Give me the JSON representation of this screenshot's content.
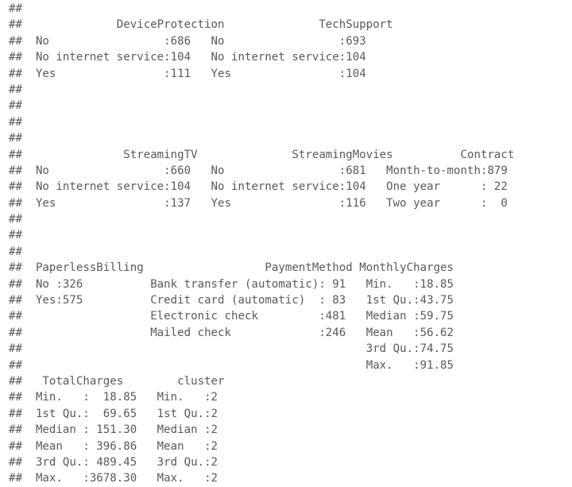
{
  "console": {
    "comment_prefix": "##",
    "text_color": "#5a5a5a",
    "background_color": "#ffffff",
    "lines": [
      "## ",
      "##              DeviceProtection              TechSupport  ",
      "##  No                 :686   No                 :693      ",
      "##  No internet service:104   No internet service:104      ",
      "##  Yes                :111   Yes                :104      ",
      "## ",
      "## ",
      "## ",
      "## ",
      "##               StreamingTV              StreamingMovies          Contract  ",
      "##  No                 :660   No                 :681   Month-to-month:879   ",
      "##  No internet service:104   No internet service:104   One year      : 22   ",
      "##  Yes                :137   Yes                :116   Two year      :  0   ",
      "## ",
      "## ",
      "## ",
      "##  PaperlessBilling                  PaymentMethod MonthlyCharges ",
      "##  No :326          Bank transfer (automatic): 91   Min.   :18.85 ",
      "##  Yes:575          Credit card (automatic)  : 83   1st Qu.:43.75 ",
      "##                   Electronic check         :481   Median :59.75 ",
      "##                   Mailed check             :246   Mean   :56.62 ",
      "##                                                   3rd Qu.:74.75 ",
      "##                                                   Max.   :91.85 ",
      "##   TotalCharges        cluster ",
      "##  Min.   :  18.85   Min.   :2  ",
      "##  1st Qu.:  69.65   1st Qu.:2  ",
      "##  Median : 151.30   Median :2  ",
      "##  Mean   : 396.86   Mean   :2  ",
      "##  3rd Qu.: 489.45   3rd Qu.:2  ",
      "##  Max.   :3678.30   Max.   :2  "
    ],
    "variables": {
      "DeviceProtection": {
        "type": "factor",
        "levels": [
          "No",
          "No internet service",
          "Yes"
        ],
        "counts": [
          686,
          104,
          111
        ]
      },
      "TechSupport": {
        "type": "factor",
        "levels": [
          "No",
          "No internet service",
          "Yes"
        ],
        "counts": [
          693,
          104,
          104
        ]
      },
      "StreamingTV": {
        "type": "factor",
        "levels": [
          "No",
          "No internet service",
          "Yes"
        ],
        "counts": [
          660,
          104,
          137
        ]
      },
      "StreamingMovies": {
        "type": "factor",
        "levels": [
          "No",
          "No internet service",
          "Yes"
        ],
        "counts": [
          681,
          104,
          116
        ]
      },
      "Contract": {
        "type": "factor",
        "levels": [
          "Month-to-month",
          "One year",
          "Two year"
        ],
        "counts": [
          879,
          22,
          0
        ]
      },
      "PaperlessBilling": {
        "type": "factor",
        "levels": [
          "No",
          "Yes"
        ],
        "counts": [
          326,
          575
        ]
      },
      "PaymentMethod": {
        "type": "factor",
        "levels": [
          "Bank transfer (automatic)",
          "Credit card (automatic)",
          "Electronic check",
          "Mailed check"
        ],
        "counts": [
          91,
          83,
          481,
          246
        ]
      },
      "MonthlyCharges": {
        "type": "numeric",
        "stats": {
          "Min.": "18.85",
          "1st Qu.": "43.75",
          "Median": "59.75",
          "Mean": "56.62",
          "3rd Qu.": "74.75",
          "Max.": "91.85"
        }
      },
      "TotalCharges": {
        "type": "numeric",
        "stats": {
          "Min.": "18.85",
          "1st Qu.": "69.65",
          "Median": "151.30",
          "Mean": "396.86",
          "3rd Qu.": "489.45",
          "Max.": "3678.30"
        }
      },
      "cluster": {
        "type": "numeric",
        "stats": {
          "Min.": "2",
          "1st Qu.": "2",
          "Median": "2",
          "Mean": "2",
          "3rd Qu.": "2",
          "Max.": "2"
        }
      }
    }
  }
}
